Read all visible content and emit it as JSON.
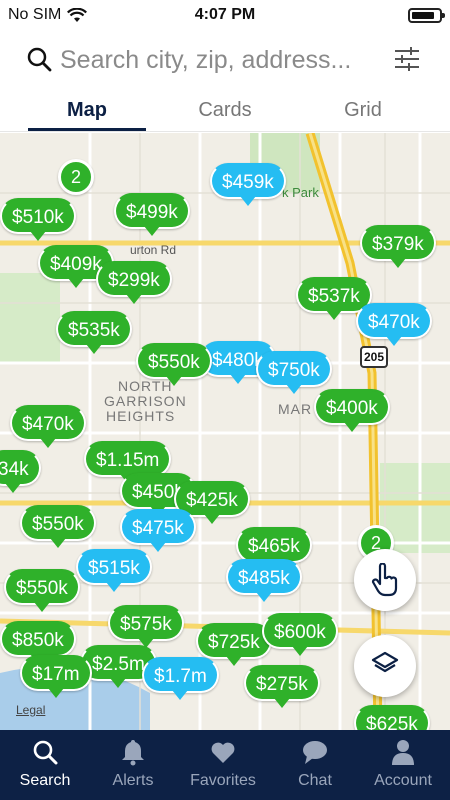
{
  "status": {
    "carrier": "No SIM",
    "time": "4:07 PM"
  },
  "search": {
    "placeholder": "Search city, zip, address..."
  },
  "tabs": [
    {
      "label": "Map"
    },
    {
      "label": "Cards"
    },
    {
      "label": "Grid"
    }
  ],
  "map": {
    "area_label_1": "NORTH",
    "area_label_2": "GARRISON",
    "area_label_3": "HEIGHTS",
    "area_label_4": "MAR",
    "park_label": "k Park",
    "road_label": "urton Rd",
    "highway": "205",
    "legal": "Legal",
    "clusters": [
      "2",
      "2"
    ],
    "pins": [
      {
        "price": "$459k",
        "color": "blue"
      },
      {
        "price": "$510k",
        "color": "green"
      },
      {
        "price": "$499k",
        "color": "green"
      },
      {
        "price": "$379k",
        "color": "green"
      },
      {
        "price": "$409k",
        "color": "green"
      },
      {
        "price": "$299k",
        "color": "green"
      },
      {
        "price": "$537k",
        "color": "green"
      },
      {
        "price": "$470k",
        "color": "blue"
      },
      {
        "price": "$535k",
        "color": "green"
      },
      {
        "price": "$550k",
        "color": "green"
      },
      {
        "price": "$480k",
        "color": "blue"
      },
      {
        "price": "$750k",
        "color": "blue"
      },
      {
        "price": "$400k",
        "color": "green"
      },
      {
        "price": "$470k",
        "color": "green"
      },
      {
        "price": "34k",
        "color": "green"
      },
      {
        "price": "$1.15m",
        "color": "green"
      },
      {
        "price": "$450k",
        "color": "green"
      },
      {
        "price": "$425k",
        "color": "green"
      },
      {
        "price": "$550k",
        "color": "green"
      },
      {
        "price": "$475k",
        "color": "blue"
      },
      {
        "price": "$465k",
        "color": "green"
      },
      {
        "price": "$515k",
        "color": "blue"
      },
      {
        "price": "$485k",
        "color": "blue"
      },
      {
        "price": "$550k",
        "color": "green"
      },
      {
        "price": "$575k",
        "color": "green"
      },
      {
        "price": "$850k",
        "color": "green"
      },
      {
        "price": "$725k",
        "color": "green"
      },
      {
        "price": "$600k",
        "color": "green"
      },
      {
        "price": "$2.5m",
        "color": "green"
      },
      {
        "price": "$1.7m",
        "color": "blue"
      },
      {
        "price": "$275k",
        "color": "green"
      },
      {
        "price": "$17m",
        "color": "green"
      },
      {
        "price": "$625k",
        "color": "green"
      }
    ]
  },
  "nav": [
    {
      "label": "Search",
      "icon": "search-icon"
    },
    {
      "label": "Alerts",
      "icon": "bell-icon"
    },
    {
      "label": "Favorites",
      "icon": "heart-icon"
    },
    {
      "label": "Chat",
      "icon": "chat-icon"
    },
    {
      "label": "Account",
      "icon": "person-icon"
    }
  ],
  "colors": {
    "accent": "#0c2044",
    "pin_green": "#2fb12a",
    "pin_blue": "#25bdf2",
    "nav_bg": "#0d2145"
  }
}
